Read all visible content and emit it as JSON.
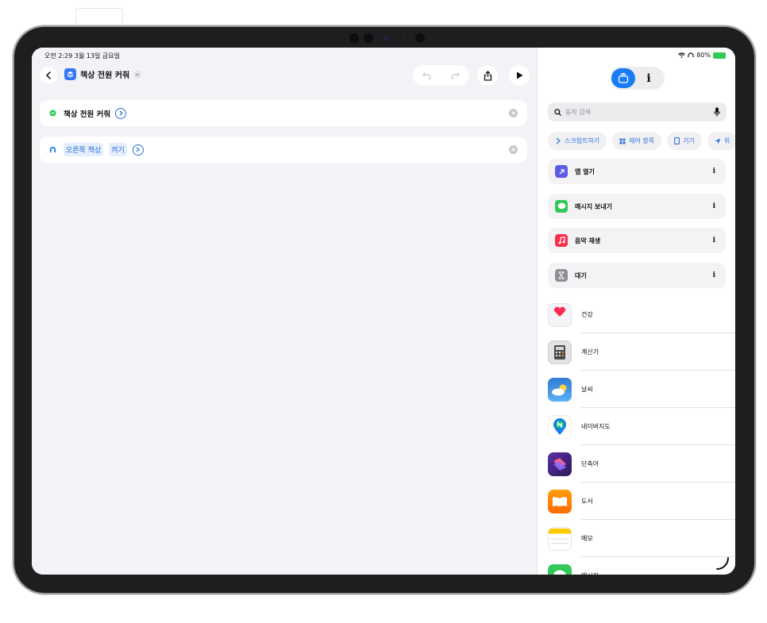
{
  "status_bar": {
    "time": "오전 2:29  3월 13일 금요일",
    "battery_percent": "80%"
  },
  "editor": {
    "back_label": "<",
    "shortcut_title": "책상 전원 커줘",
    "actions": [
      {
        "icon": "desk-sensor-icon",
        "color": "#34c759",
        "text": "책상 전원 커줘"
      },
      {
        "icon": "desk-up-icon",
        "color": "#1a7cf5",
        "device": "오른쪽 책상",
        "state": "켜기"
      }
    ]
  },
  "panel": {
    "tabs": {
      "library": "library-icon",
      "info": "i"
    },
    "search_placeholder": "동작 검색",
    "chips": [
      {
        "icon": "script-icon",
        "label": "스크립트하기"
      },
      {
        "icon": "control-icon",
        "label": "제어 항목"
      },
      {
        "icon": "device-icon",
        "label": "기기"
      },
      {
        "icon": "location-icon",
        "label": "위"
      }
    ],
    "suggestions": [
      {
        "icon": "open-app-icon",
        "label": "앱 열기",
        "color": "#5e5ce6"
      },
      {
        "icon": "message-icon",
        "label": "메시지 보내기",
        "color": "#34c759"
      },
      {
        "icon": "music-icon",
        "label": "음악 재생",
        "color": "#fa2d48"
      },
      {
        "icon": "hourglass-icon",
        "label": "대기",
        "color": "#8e8e93"
      }
    ],
    "apps": [
      {
        "icon": "health-icon",
        "label": "건강"
      },
      {
        "icon": "calculator-icon",
        "label": "계산기"
      },
      {
        "icon": "weather-icon",
        "label": "날씨"
      },
      {
        "icon": "naver-map-icon",
        "label": "네이버지도"
      },
      {
        "icon": "shortcuts-icon",
        "label": "단축어"
      },
      {
        "icon": "books-icon",
        "label": "도서"
      },
      {
        "icon": "notes-icon",
        "label": "메모"
      },
      {
        "icon": "messages-icon",
        "label": "메시지"
      }
    ]
  }
}
